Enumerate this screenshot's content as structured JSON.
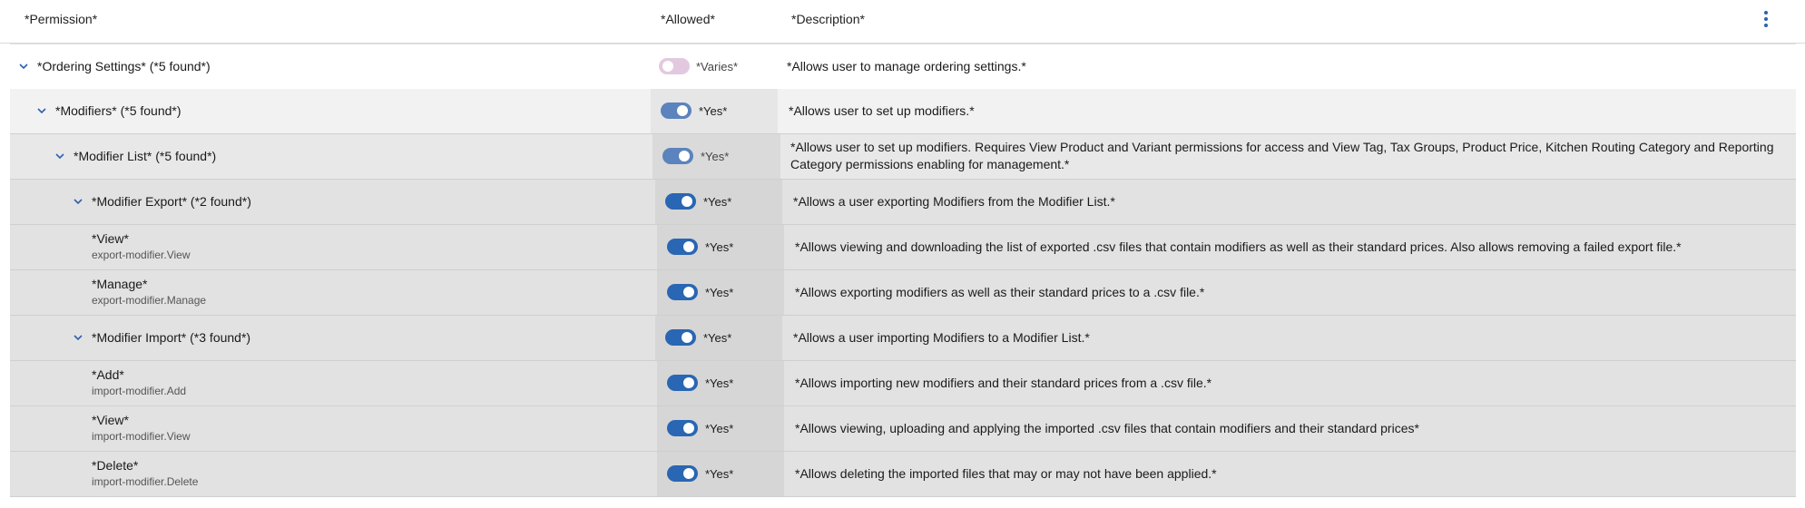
{
  "header": {
    "permission": "*Permission*",
    "allowed": "*Allowed*",
    "description": "*Description*"
  },
  "rows": [
    {
      "label": "*Ordering Settings* (*5 found*)",
      "allowed": "*Varies*",
      "description": "*Allows user to manage ordering settings.*"
    },
    {
      "label": "*Modifiers* (*5 found*)",
      "allowed": "*Yes*",
      "description": "*Allows user to set up modifiers.*"
    },
    {
      "label": "*Modifier List* (*5 found*)",
      "allowed": "*Yes*",
      "description": "*Allows user to set up modifiers. Requires View Product and Variant permissions for access and View Tag, Tax Groups, Product Price, Kitchen Routing Category and Reporting Category permissions enabling for management.*"
    },
    {
      "label": "*Modifier Export* (*2 found*)",
      "allowed": "*Yes*",
      "description": "*Allows a user exporting Modifiers from the Modifier List.*"
    },
    {
      "label": "*View*",
      "code": "export-modifier.View",
      "allowed": "*Yes*",
      "description": "*Allows viewing and downloading the list of exported .csv files that contain modifiers as well as their standard prices. Also allows removing a failed export file.*"
    },
    {
      "label": "*Manage*",
      "code": "export-modifier.Manage",
      "allowed": "*Yes*",
      "description": "*Allows exporting modifiers as well as their standard prices to a .csv file.*"
    },
    {
      "label": "*Modifier Import* (*3 found*)",
      "allowed": "*Yes*",
      "description": "*Allows a user importing Modifiers to a Modifier List.*"
    },
    {
      "label": "*Add*",
      "code": "import-modifier.Add",
      "allowed": "*Yes*",
      "description": "*Allows importing new modifiers and their standard prices from a .csv file.*"
    },
    {
      "label": "*View*",
      "code": "import-modifier.View",
      "allowed": "*Yes*",
      "description": "*Allows viewing, uploading and applying the imported .csv files that contain modifiers and their standard prices*"
    },
    {
      "label": "*Delete*",
      "code": "import-modifier.Delete",
      "allowed": "*Yes*",
      "description": "*Allows deleting the imported files that may or may not have been applied.*"
    }
  ],
  "colors": {
    "accent": "#2b62ad",
    "toggle_on": "#2966b3",
    "toggle_on_muted": "#5b83bd",
    "toggle_varies": "#e3c9e0"
  }
}
